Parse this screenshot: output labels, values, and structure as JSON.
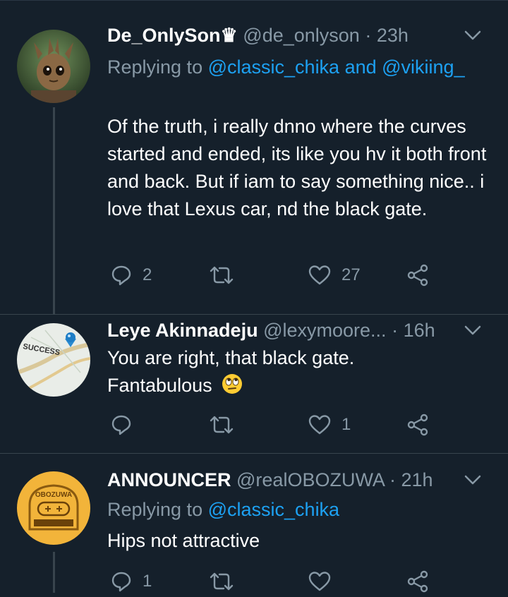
{
  "tweets": [
    {
      "name": "De_OnlySon",
      "badge": "♛",
      "handle": "@de_onlyson",
      "time": "23h",
      "replying_label": "Replying to",
      "replying_to": "@classic_chika and @vikiing_",
      "text": "Of the truth, i really dnno where the curves started and ended, its like you hv it both front and back. But if iam to say something nice.. i love that Lexus car, nd the black gate.",
      "replies": "2",
      "retweets": "",
      "likes": "27"
    },
    {
      "name": "Leye Akinnadeju",
      "handle": "@lexymoore...",
      "time": "16h",
      "text": "You are right, that black gate. Fantabulous",
      "emoji": "🙄",
      "avatar_text": "SUCCESS",
      "replies": "",
      "retweets": "",
      "likes": "1"
    },
    {
      "name": "ANNOUNCER",
      "handle": "@realOBOZUWA",
      "time": "21h",
      "replying_label": "Replying to",
      "replying_to": "@classic_chika",
      "text": "Hips not attractive",
      "avatar_text": "OBOZUWA",
      "replies": "1",
      "retweets": "",
      "likes": ""
    }
  ],
  "colors": {
    "background": "#15202b",
    "link": "#1da1f2",
    "secondary_text": "#8899a6",
    "divider": "#38444d"
  },
  "icons": [
    "reply-icon",
    "retweet-icon",
    "like-icon",
    "share-icon",
    "chevron-down-icon"
  ]
}
